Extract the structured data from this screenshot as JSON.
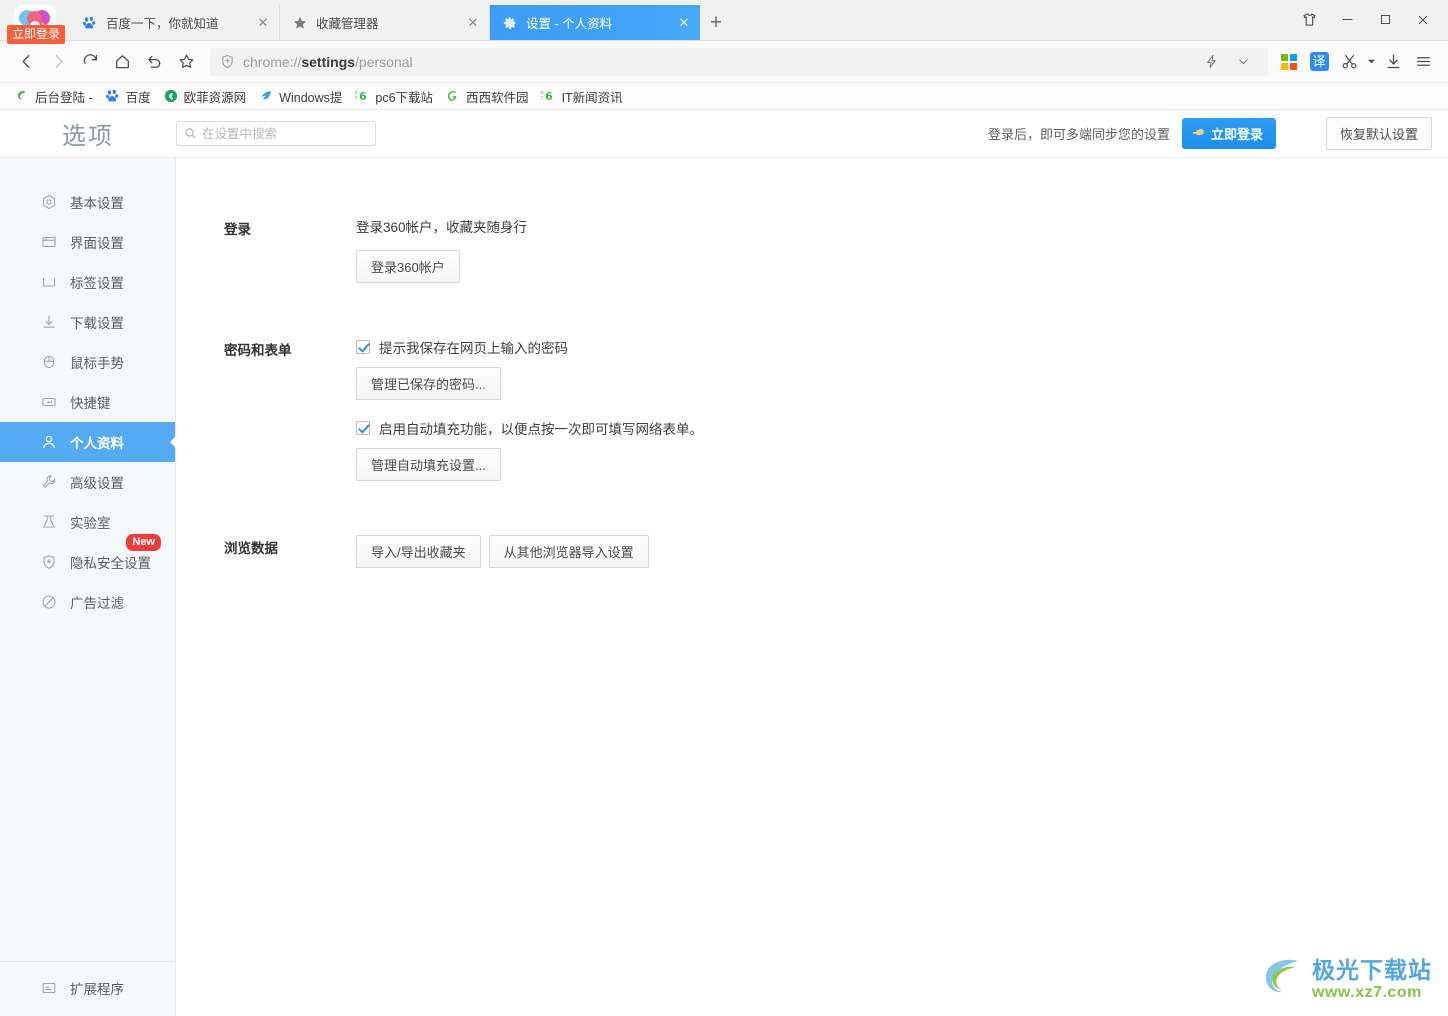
{
  "window": {
    "controls": [
      {
        "name": "skin-icon",
        "glyph": "skin"
      },
      {
        "name": "minimize",
        "glyph": "minimize"
      },
      {
        "name": "maximize",
        "glyph": "maximize"
      },
      {
        "name": "close",
        "glyph": "close"
      }
    ]
  },
  "browser": {
    "login_badge": "立即登录",
    "tabs": [
      {
        "title": "百度一下，你就知道",
        "favicon": "baidu-paw-icon",
        "active": false,
        "close": "✕"
      },
      {
        "title": "收藏管理器",
        "favicon": "star-icon",
        "active": false,
        "close": "✕"
      },
      {
        "title": "设置 - 个人资料",
        "favicon": "gear-icon",
        "active": true,
        "close": "✕"
      }
    ],
    "new_tab_label": "+",
    "url": {
      "prefix": "chrome://",
      "bold": "settings",
      "suffix": "/personal",
      "full": "chrome://settings/personal"
    },
    "nav": {
      "back": "‹",
      "forward": "›",
      "reload": "⟳",
      "home": "⌂",
      "undo": "↺",
      "bookmark": "☆"
    },
    "toolbar_right": [
      {
        "name": "lightning-icon",
        "label": "⚡"
      },
      {
        "name": "chevron-down-icon",
        "label": "⌄"
      },
      {
        "name": "microsoft-grid-icon",
        "label": ""
      },
      {
        "name": "translate-icon",
        "label": "译"
      },
      {
        "name": "scissors-icon",
        "label": "✂"
      },
      {
        "name": "scissors-dropdown-icon",
        "label": "▾"
      },
      {
        "name": "download-icon",
        "label": "⤓"
      },
      {
        "name": "menu-icon",
        "label": "☰"
      }
    ],
    "bookmarks": [
      {
        "label": "后台登陆 -",
        "icon": "swirl-green-icon",
        "color": "#4caf50"
      },
      {
        "label": "百度",
        "icon": "baidu-paw-icon",
        "color": "#2d7ff9"
      },
      {
        "label": "欧菲资源网",
        "icon": "circle-arrow-icon",
        "color": "#1aa260"
      },
      {
        "label": "Windows提",
        "icon": "windows-feather-icon",
        "color": "#3d9ae0"
      },
      {
        "label": "pc6下载站",
        "icon": "pc6-icon",
        "color": "#3ab54a"
      },
      {
        "label": "西西软件园",
        "icon": "g-circle-icon",
        "color": "#4caf50"
      },
      {
        "label": "IT新闻资讯",
        "icon": "pc6-icon",
        "color": "#3ab54a"
      }
    ]
  },
  "settings": {
    "title": "选项",
    "search": {
      "placeholder": "在设置中搜索",
      "value": "",
      "icon": "search-icon"
    },
    "header": {
      "hint": "登录后，即可多端同步您的设置",
      "login_button": "立即登录",
      "login_icon": "hand-point-icon",
      "reset_button": "恢复默认设置"
    },
    "sidebar": {
      "items": [
        {
          "label": "基本设置",
          "icon": "target-circle-icon",
          "active": false,
          "badge": null
        },
        {
          "label": "界面设置",
          "icon": "window-layout-icon",
          "active": false,
          "badge": null
        },
        {
          "label": "标签设置",
          "icon": "tab-icon",
          "active": false,
          "badge": null
        },
        {
          "label": "下载设置",
          "icon": "download-arrow-icon",
          "active": false,
          "badge": null
        },
        {
          "label": "鼠标手势",
          "icon": "mouse-icon",
          "active": false,
          "badge": null
        },
        {
          "label": "快捷键",
          "icon": "keyboard-key-icon",
          "active": false,
          "badge": null
        },
        {
          "label": "个人资料",
          "icon": "user-icon",
          "active": true,
          "badge": null
        },
        {
          "label": "高级设置",
          "icon": "wrench-icon",
          "active": false,
          "badge": null
        },
        {
          "label": "实验室",
          "icon": "flask-icon",
          "active": false,
          "badge": null
        },
        {
          "label": "隐私安全设置",
          "icon": "shield-plus-icon",
          "active": false,
          "badge": "New"
        },
        {
          "label": "广告过滤",
          "icon": "block-circle-icon",
          "active": false,
          "badge": null
        }
      ],
      "bottom_item": {
        "label": "扩展程序",
        "icon": "extension-icon"
      }
    },
    "sections": [
      {
        "id": "login",
        "label": "登录",
        "description": "登录360帐户，收藏夹随身行",
        "button": "登录360帐户"
      },
      {
        "id": "passwords",
        "label": "密码和表单",
        "checkbox1": {
          "label": "提示我保存在网页上输入的密码",
          "checked": true
        },
        "button1": "管理已保存的密码...",
        "checkbox2": {
          "label": "启用自动填充功能，以便点按一次即可填写网络表单。",
          "checked": true
        },
        "button2": "管理自动填充设置..."
      },
      {
        "id": "browsing-data",
        "label": "浏览数据",
        "button1": "导入/导出收藏夹",
        "button2": "从其他浏览器导入设置"
      }
    ]
  },
  "watermark": {
    "line1": "极光下载站",
    "line2": "www.xz7.com"
  }
}
